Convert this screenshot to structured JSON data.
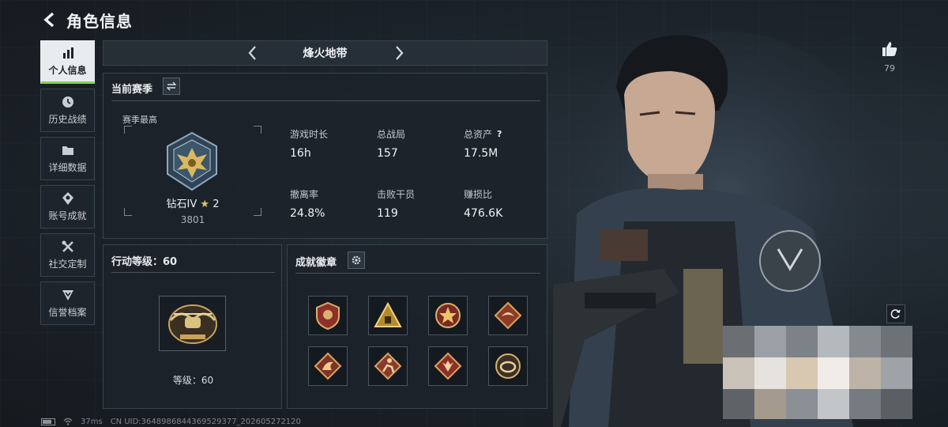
{
  "header": {
    "title": "角色信息"
  },
  "nav": {
    "items": [
      {
        "label": "个人信息",
        "icon": "bar-chart-icon",
        "active": true
      },
      {
        "label": "历史战绩",
        "icon": "clock-icon"
      },
      {
        "label": "详细数据",
        "icon": "folder-icon"
      },
      {
        "label": "账号成就",
        "icon": "achievement-icon"
      },
      {
        "label": "社交定制",
        "icon": "tools-icon"
      },
      {
        "label": "信誉档案",
        "icon": "credit-icon"
      }
    ]
  },
  "mode": {
    "label": "烽火地带"
  },
  "season": {
    "title": "当前赛季",
    "best_label": "赛季最高",
    "rank_name": "钻石IV",
    "rank_stars": "2",
    "rank_points": "3801",
    "stats": [
      {
        "label": "游戏时长",
        "value": "16h"
      },
      {
        "label": "总战局",
        "value": "157"
      },
      {
        "label": "总资产",
        "value": "17.5M",
        "help": "?"
      },
      {
        "label": "撤离率",
        "value": "24.8%"
      },
      {
        "label": "击败干员",
        "value": "119"
      },
      {
        "label": "赚损比",
        "value": "476.6K"
      }
    ]
  },
  "level": {
    "title": "行动等级：60",
    "level_text": "等级：60"
  },
  "badges": {
    "title": "成就徽章"
  },
  "social": {
    "like_count": "79"
  },
  "status": {
    "ping": "37ms",
    "uid": "CN UID:3648986844369529377_202605272120"
  },
  "colors": {
    "accent": "#7fd54c",
    "gold": "#e2c66f"
  }
}
